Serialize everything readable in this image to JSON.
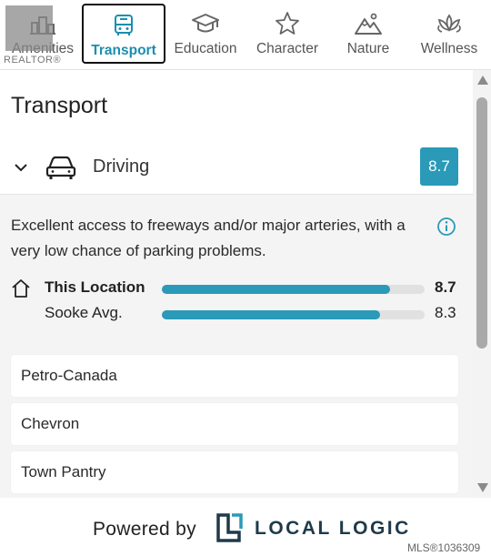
{
  "watermark": {
    "realtor": "REALTOR®",
    "mls": "MLS®1036309"
  },
  "tabs": [
    {
      "label": "Amenities",
      "icon": "amenities-icon",
      "active": false
    },
    {
      "label": "Transport",
      "icon": "bus-icon",
      "active": true
    },
    {
      "label": "Education",
      "icon": "graduation-cap-icon",
      "active": false
    },
    {
      "label": "Character",
      "icon": "star-icon",
      "active": false
    },
    {
      "label": "Nature",
      "icon": "mountain-icon",
      "active": false
    },
    {
      "label": "Wellness",
      "icon": "lotus-icon",
      "active": false
    }
  ],
  "panel": {
    "title": "Transport",
    "section": {
      "label": "Driving",
      "score": "8.7",
      "description": "Excellent access to freeways and/or major arteries, with a very low chance of parking problems.",
      "comparisons": [
        {
          "label": "This Location",
          "value": "8.7",
          "fraction": 0.87
        },
        {
          "label": "Sooke Avg.",
          "value": "8.3",
          "fraction": 0.83
        }
      ],
      "places": [
        "Petro-Canada",
        "Chevron",
        "Town Pantry"
      ]
    }
  },
  "footer": {
    "powered_by": "Powered by",
    "brand": "LOCAL LOGIC"
  },
  "colors": {
    "accent": "#2a9ab8",
    "brand_dark": "#1f3a4a",
    "track": "#e1e1e1"
  }
}
